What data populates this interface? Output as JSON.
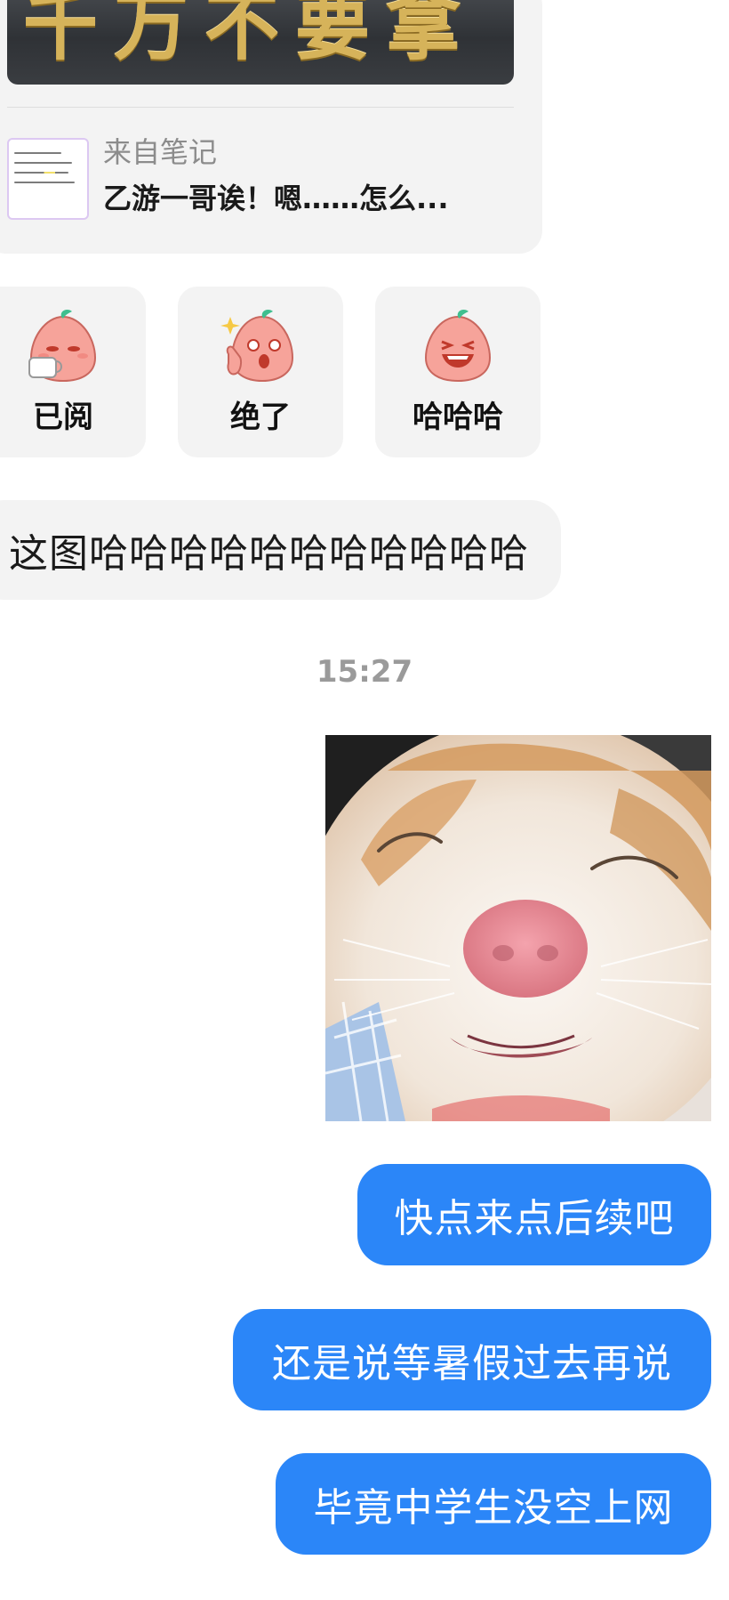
{
  "shared_note": {
    "image_text": "千万不要拿",
    "source_label": "来自笔记",
    "title": "乙游一哥诶！嗯……怎么..."
  },
  "sticker_replies": [
    {
      "label": "已阅",
      "icon": "peach-mascot-tea-icon"
    },
    {
      "label": "绝了",
      "icon": "peach-mascot-thumbs-up-icon"
    },
    {
      "label": "哈哈哈",
      "icon": "peach-mascot-laughing-icon"
    }
  ],
  "incoming_message": {
    "text": "这图哈哈哈哈哈哈哈哈哈哈哈"
  },
  "timestamp": "15:27",
  "outgoing_image": {
    "subject": "cat-closeup-photo"
  },
  "outgoing_messages": [
    {
      "text": "快点来点后续吧"
    },
    {
      "text": "还是说等暑假过去再说"
    },
    {
      "text": "毕竟中学生没空上网"
    }
  ],
  "colors": {
    "outgoing_bubble": "#2b86f8",
    "incoming_bubble": "#f3f3f3",
    "timestamp": "#9a9a9a"
  }
}
